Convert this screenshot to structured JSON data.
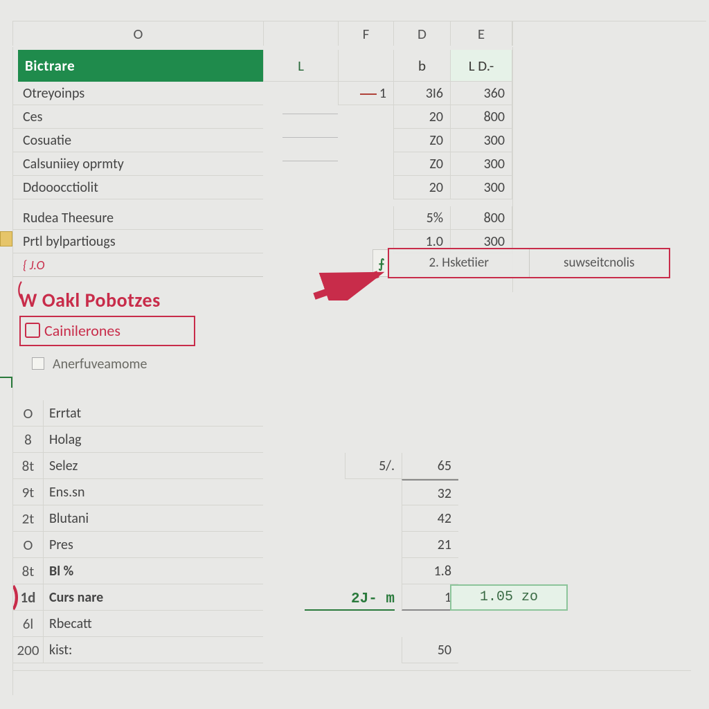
{
  "columns": [
    "O",
    "F",
    "D",
    "E"
  ],
  "header": {
    "title": "Bictrare",
    "l": "L",
    "d": "b",
    "e": "L D.-"
  },
  "rows": [
    {
      "name": "Otreyoinps",
      "f": "1",
      "d": "3I6",
      "e": "360"
    },
    {
      "name": "Ces",
      "d": "20",
      "e": "800"
    },
    {
      "name": "Cosuatie",
      "d": "Z0",
      "e": "300"
    },
    {
      "name": "Calsuniiey oprmty",
      "d": "Z0",
      "e": "300"
    },
    {
      "name": "Ddooocctiolit",
      "d": "20",
      "e": "300"
    },
    {
      "name": "Rudea Theesure",
      "d": "5%",
      "e": "800"
    },
    {
      "name": "Prtl  bylpartiougs",
      "d": "1.0",
      "e": "300"
    },
    {
      "mark": "J.O"
    }
  ],
  "callout": {
    "tabs": [
      "2. Hsketiier",
      "suwseitcnolis"
    ]
  },
  "annotation": {
    "title": "W Oakl Pobotzes",
    "highlight": "Cainilerones",
    "secondary": "Anerfuveamome"
  },
  "list": [
    {
      "num": "O",
      "label": "Errtat"
    },
    {
      "num": "8",
      "label": "Holag"
    },
    {
      "num": "8t",
      "label": "Selez",
      "f": "5/.",
      "d": "65"
    },
    {
      "num": "9t",
      "label": "Ens.sn",
      "d": "32"
    },
    {
      "num": "2t",
      "label": "Blutani",
      "d": "42"
    },
    {
      "num": "O",
      "label": "Pres",
      "d": "21"
    },
    {
      "num": "8t",
      "label": "Bl %",
      "d": "1.8"
    },
    {
      "num": "1d",
      "label": "Curs nare",
      "f": "2J-  m",
      "d": "1",
      "e": "1.05  zo"
    },
    {
      "num": "6l",
      "label": "Rbecatt"
    },
    {
      "num": "200",
      "label": "kist:",
      "d": "50"
    }
  ]
}
